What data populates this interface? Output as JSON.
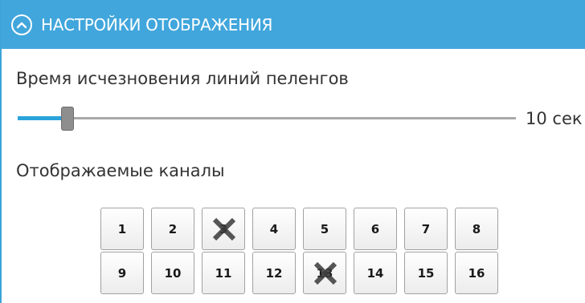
{
  "header": {
    "title": "НАСТРОЙКИ ОТОБРАЖЕНИЯ",
    "collapse_icon": "chevron-up-circle-icon"
  },
  "fade_time": {
    "label": "Время исчезновения линий пеленгов",
    "value_text": "10 сек",
    "slider_fraction": 0.1
  },
  "channels": {
    "label": "Отображаемые каналы",
    "rows": [
      [
        {
          "label": "1",
          "disabled": false
        },
        {
          "label": "2",
          "disabled": false
        },
        {
          "label": "3",
          "disabled": true
        },
        {
          "label": "4",
          "disabled": false
        },
        {
          "label": "5",
          "disabled": false
        },
        {
          "label": "6",
          "disabled": false
        },
        {
          "label": "7",
          "disabled": false
        },
        {
          "label": "8",
          "disabled": false
        }
      ],
      [
        {
          "label": "9",
          "disabled": false
        },
        {
          "label": "10",
          "disabled": false
        },
        {
          "label": "11",
          "disabled": false
        },
        {
          "label": "12",
          "disabled": false
        },
        {
          "label": "13",
          "disabled": true
        },
        {
          "label": "14",
          "disabled": false
        },
        {
          "label": "15",
          "disabled": false
        },
        {
          "label": "16",
          "disabled": false
        }
      ]
    ]
  },
  "colors": {
    "header_bg": "#41a6dc",
    "slider_fill": "#2ba3dc",
    "disabled_mark": "#3a3a3a"
  }
}
